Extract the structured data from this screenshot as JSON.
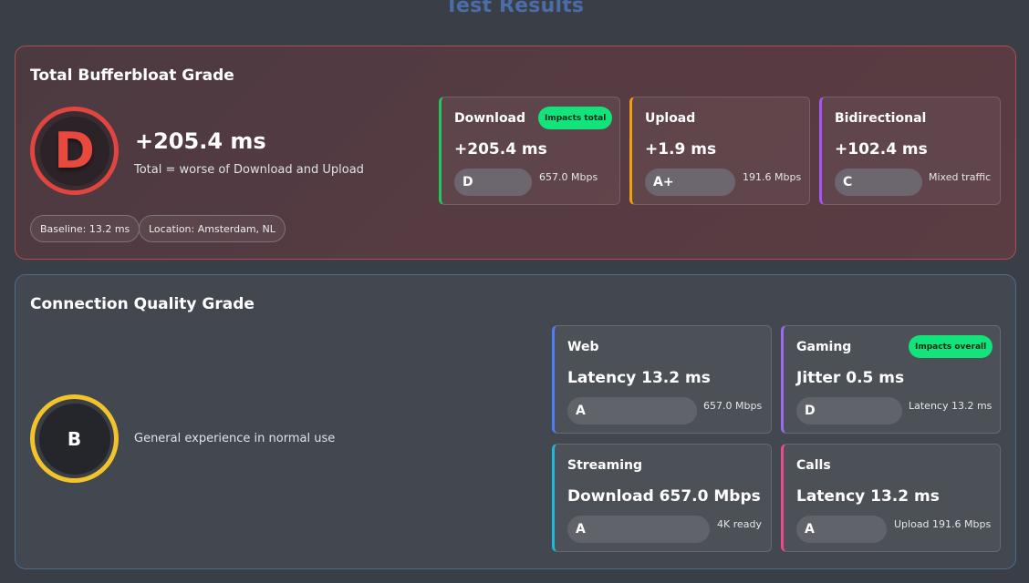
{
  "page": {
    "title": "Test Results"
  },
  "bufferbloat": {
    "title": "Total Bufferbloat Grade",
    "grade": "D",
    "total_value": "+205.4 ms",
    "description": "Total = worse of Download and Upload",
    "chips": {
      "baseline": "Baseline: 13.2 ms",
      "location": "Location: Amsterdam, NL"
    },
    "cards": [
      {
        "label": "Download",
        "value": "+205.4 ms",
        "grade": "D",
        "note": "657.0 Mbps",
        "badge": "Impacts total",
        "accent": "#22c55e"
      },
      {
        "label": "Upload",
        "value": "+1.9 ms",
        "grade": "A+",
        "note": "191.6 Mbps",
        "accent": "#f59e0b"
      },
      {
        "label": "Bidirectional",
        "value": "+102.4 ms",
        "grade": "C",
        "note": "Mixed traffic",
        "accent": "#a855f7"
      }
    ]
  },
  "quality": {
    "title": "Connection Quality Grade",
    "grade": "B",
    "description": "General experience in normal use",
    "cards": [
      {
        "label": "Web",
        "value": "Latency 13.2 ms",
        "grade": "A",
        "note": "657.0 Mbps",
        "accent": "#4f7df3"
      },
      {
        "label": "Gaming",
        "value": "Jitter 0.5 ms",
        "grade": "D",
        "note": "Latency 13.2 ms",
        "badge": "Impacts overall",
        "accent": "#9b6cf0"
      },
      {
        "label": "Streaming",
        "value": "Download 657.0 Mbps",
        "grade": "A",
        "note": "4K ready",
        "accent": "#1fb8d6"
      },
      {
        "label": "Calls",
        "value": "Latency 13.2 ms",
        "grade": "A",
        "note": "Upload 191.6 Mbps",
        "accent": "#ec4c8a"
      }
    ]
  },
  "colors": {
    "bloat_border": "#b34a55",
    "quality_border": "#4d6a8f",
    "grade_d_ring": "#e0463f",
    "grade_b_ring": "#f3c32b",
    "badge_green": "#12e37a"
  }
}
